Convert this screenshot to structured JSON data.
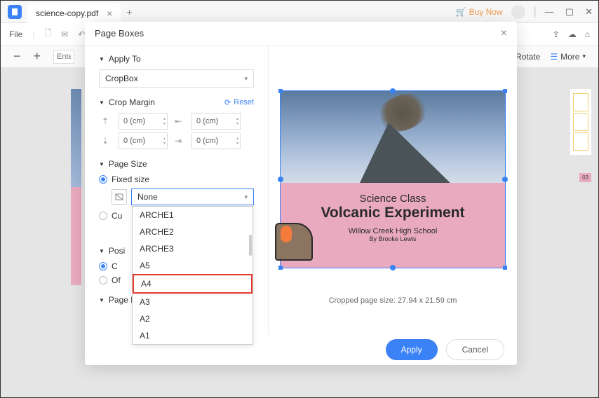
{
  "titlebar": {
    "tab_label": "science-copy.pdf",
    "buy_now": "Buy Now"
  },
  "toolbar": {
    "file": "File",
    "page_placeholder": "Enter",
    "rotate": "Rotate",
    "more": "More"
  },
  "dialog": {
    "title": "Page Boxes",
    "apply_to": {
      "label": "Apply To",
      "value": "CropBox"
    },
    "crop_margin": {
      "label": "Crop Margin",
      "reset": "Reset",
      "top": "0 (cm)",
      "bottom": "0 (cm)",
      "left": "0 (cm)",
      "right": "0 (cm)"
    },
    "page_size": {
      "label": "Page Size",
      "fixed_label": "Fixed size",
      "custom_label": "Cu",
      "selected": "None",
      "options": [
        "ARCHE1",
        "ARCHE2",
        "ARCHE3",
        "A5",
        "A4",
        "A3",
        "A2",
        "A1"
      ]
    },
    "position": {
      "label": "Posi",
      "center": "C",
      "offset": "Of"
    },
    "page_range": {
      "label": "Page Range"
    },
    "preview": {
      "title1": "Science Class",
      "title2": "Volcanic Experiment",
      "school": "Willow Creek High School",
      "author": "By Brooke Lewis",
      "info": "Cropped page size: 27.94 x 21.59 cm"
    },
    "buttons": {
      "apply": "Apply",
      "cancel": "Cancel"
    }
  },
  "thumbnail": {
    "page_label": "03"
  }
}
